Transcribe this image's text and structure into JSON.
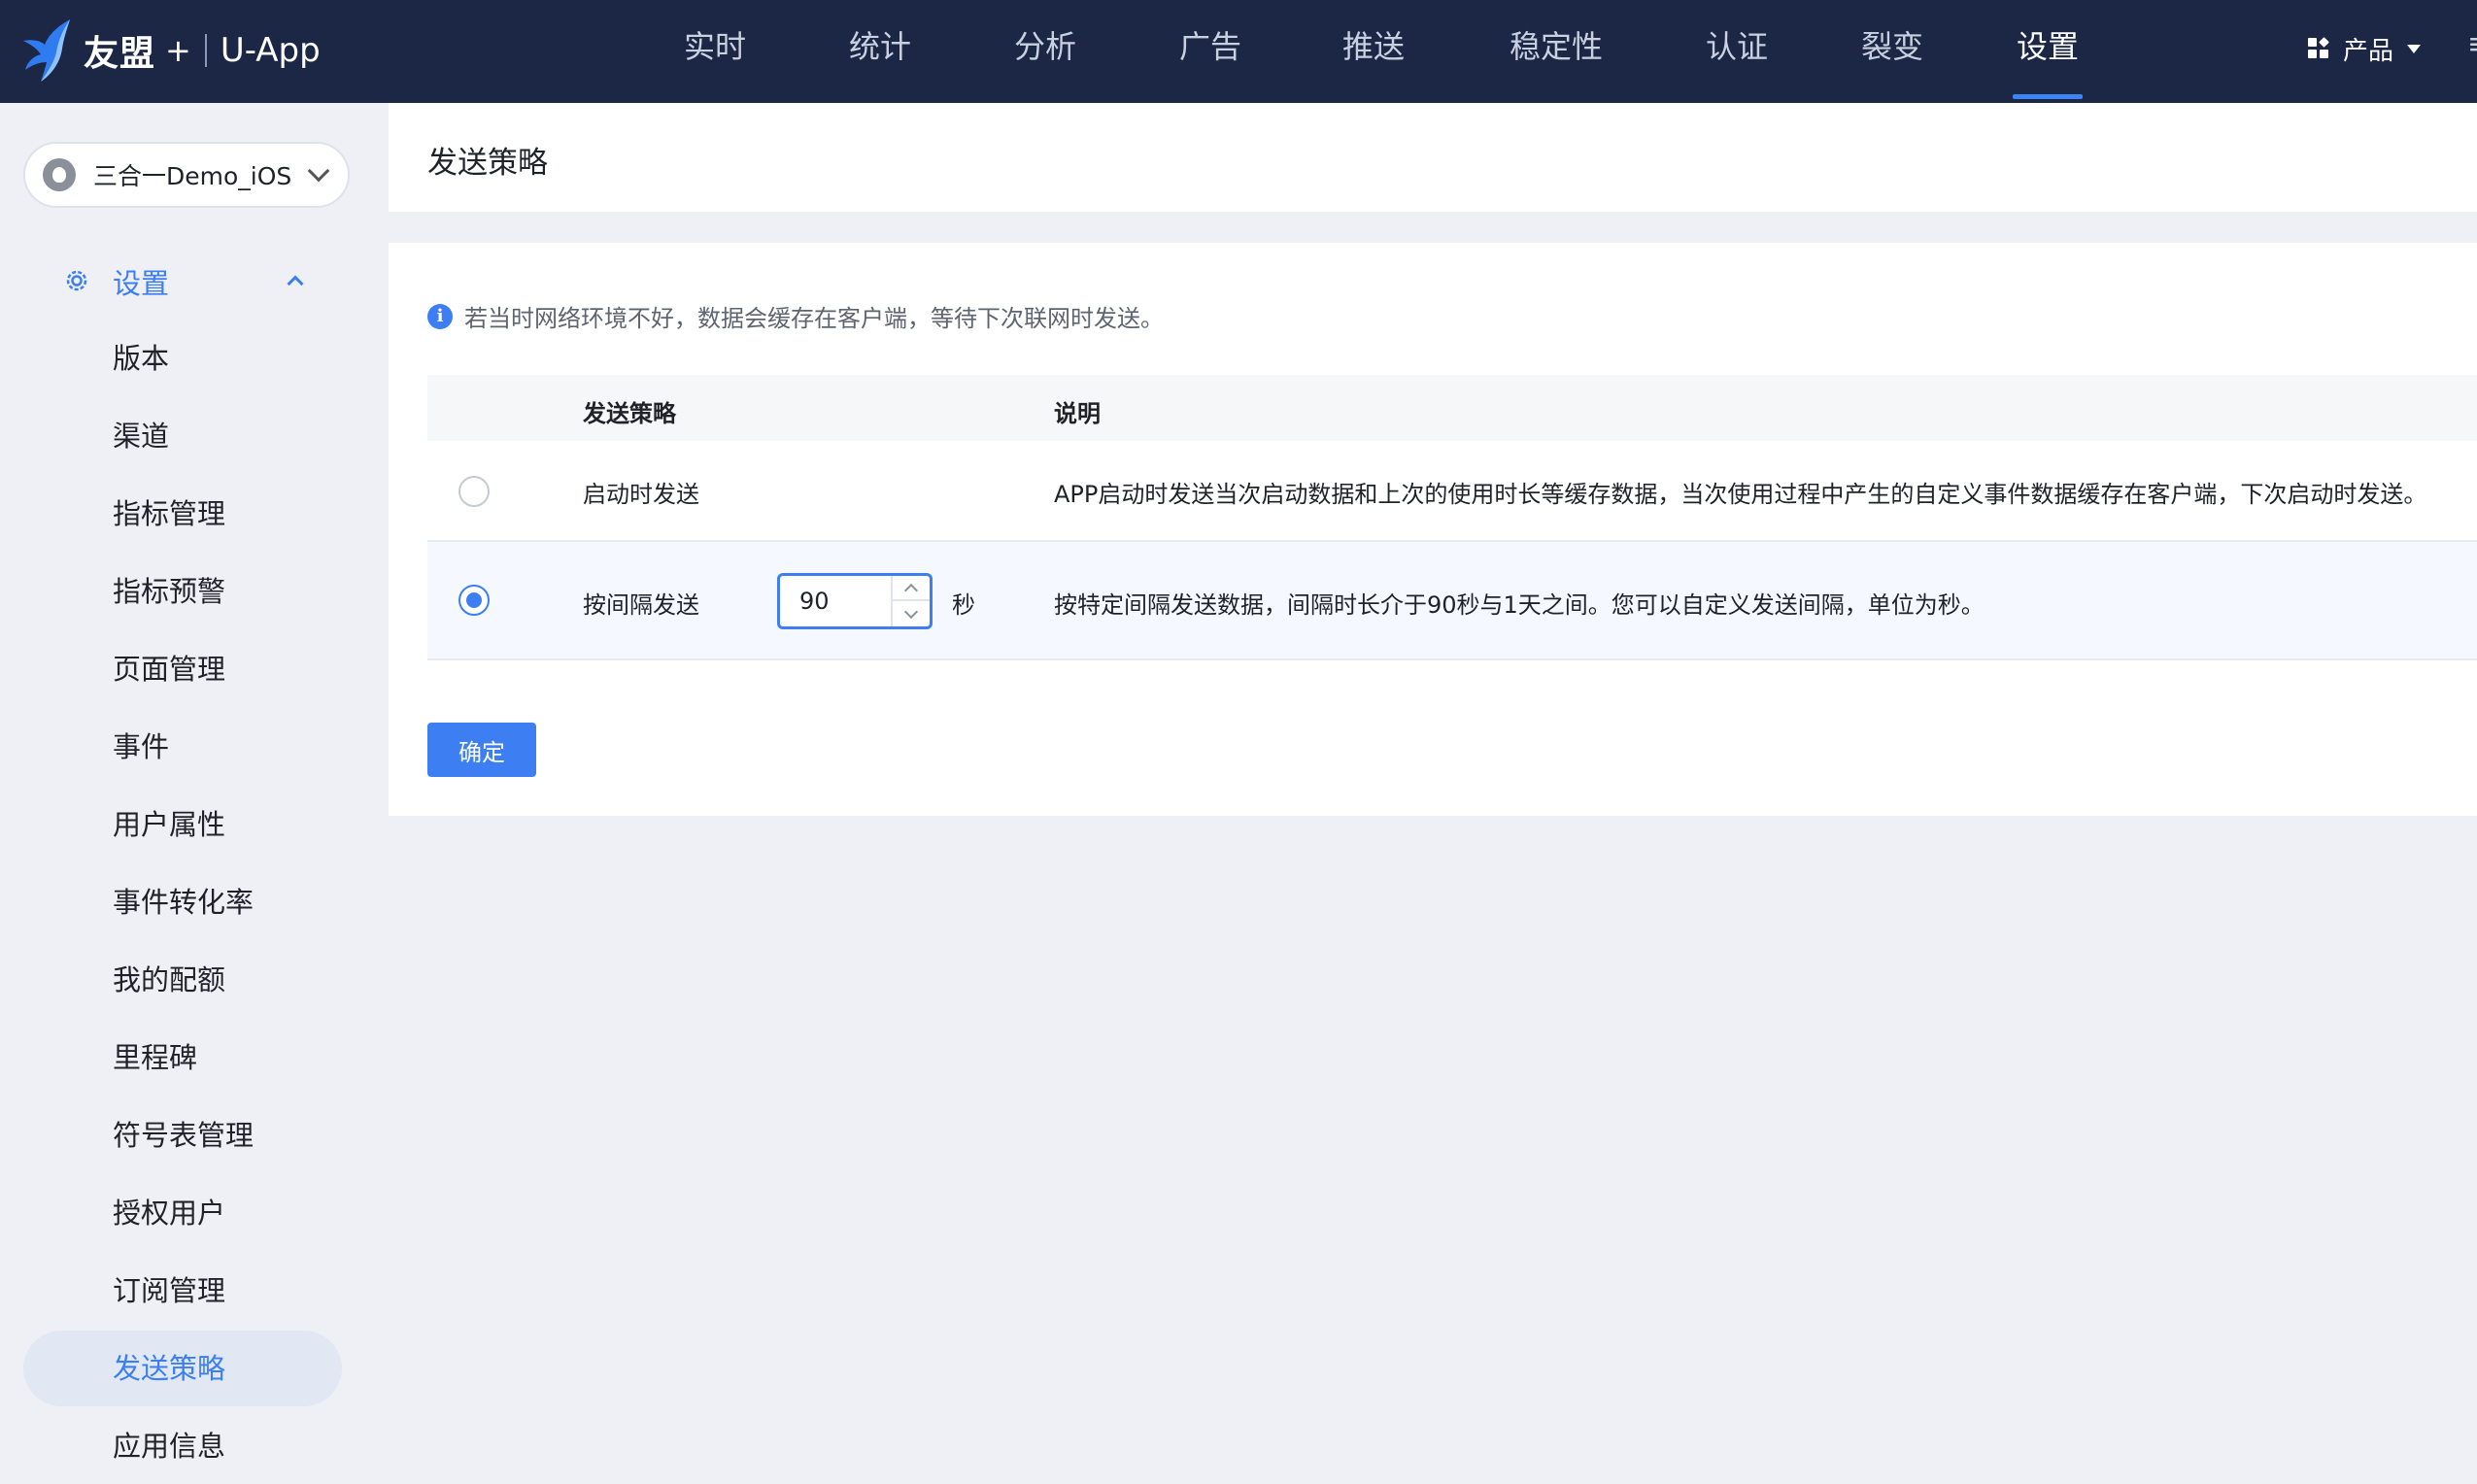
{
  "topbar": {
    "brand": "友盟",
    "plus": "+",
    "product": "U-App",
    "nav": [
      {
        "label": "实时"
      },
      {
        "label": "统计"
      },
      {
        "label": "分析"
      },
      {
        "label": "广告"
      },
      {
        "label": "推送"
      },
      {
        "label": "稳定性"
      },
      {
        "label": "认证"
      },
      {
        "label": "裂变"
      },
      {
        "label": "设置",
        "active": true
      }
    ],
    "product_switch_label": "产品"
  },
  "sidebar": {
    "app_name": "三合一Demo_iOS",
    "group_title": "设置",
    "items": [
      {
        "label": "版本"
      },
      {
        "label": "渠道"
      },
      {
        "label": "指标管理"
      },
      {
        "label": "指标预警"
      },
      {
        "label": "页面管理"
      },
      {
        "label": "事件"
      },
      {
        "label": "用户属性"
      },
      {
        "label": "事件转化率"
      },
      {
        "label": "我的配额"
      },
      {
        "label": "里程碑"
      },
      {
        "label": "符号表管理"
      },
      {
        "label": "授权用户"
      },
      {
        "label": "订阅管理"
      },
      {
        "label": "发送策略",
        "active": true
      },
      {
        "label": "应用信息"
      }
    ]
  },
  "page": {
    "title": "发送策略",
    "info": "若当时网络环境不好，数据会缓存在客户端，等待下次联网时发送。",
    "table": {
      "headers": [
        "发送策略",
        "说明"
      ],
      "rows": [
        {
          "name": "启动时发送",
          "desc": "APP启动时发送当次启动数据和上次的使用时长等缓存数据，当次使用过程中产生的自定义事件数据缓存在客户端，下次启动时发送。",
          "checked": false
        },
        {
          "name": "按间隔发送",
          "desc": "按特定间隔发送数据，间隔时长介于90秒与1天之间。您可以自定义发送间隔，单位为秒。",
          "checked": true,
          "interval_value": "90",
          "unit": "秒"
        }
      ]
    },
    "confirm_label": "确定"
  },
  "colors": {
    "topbar_bg": "#1b2745",
    "accent": "#3d7ff2",
    "page_bg": "#eef0f5"
  }
}
